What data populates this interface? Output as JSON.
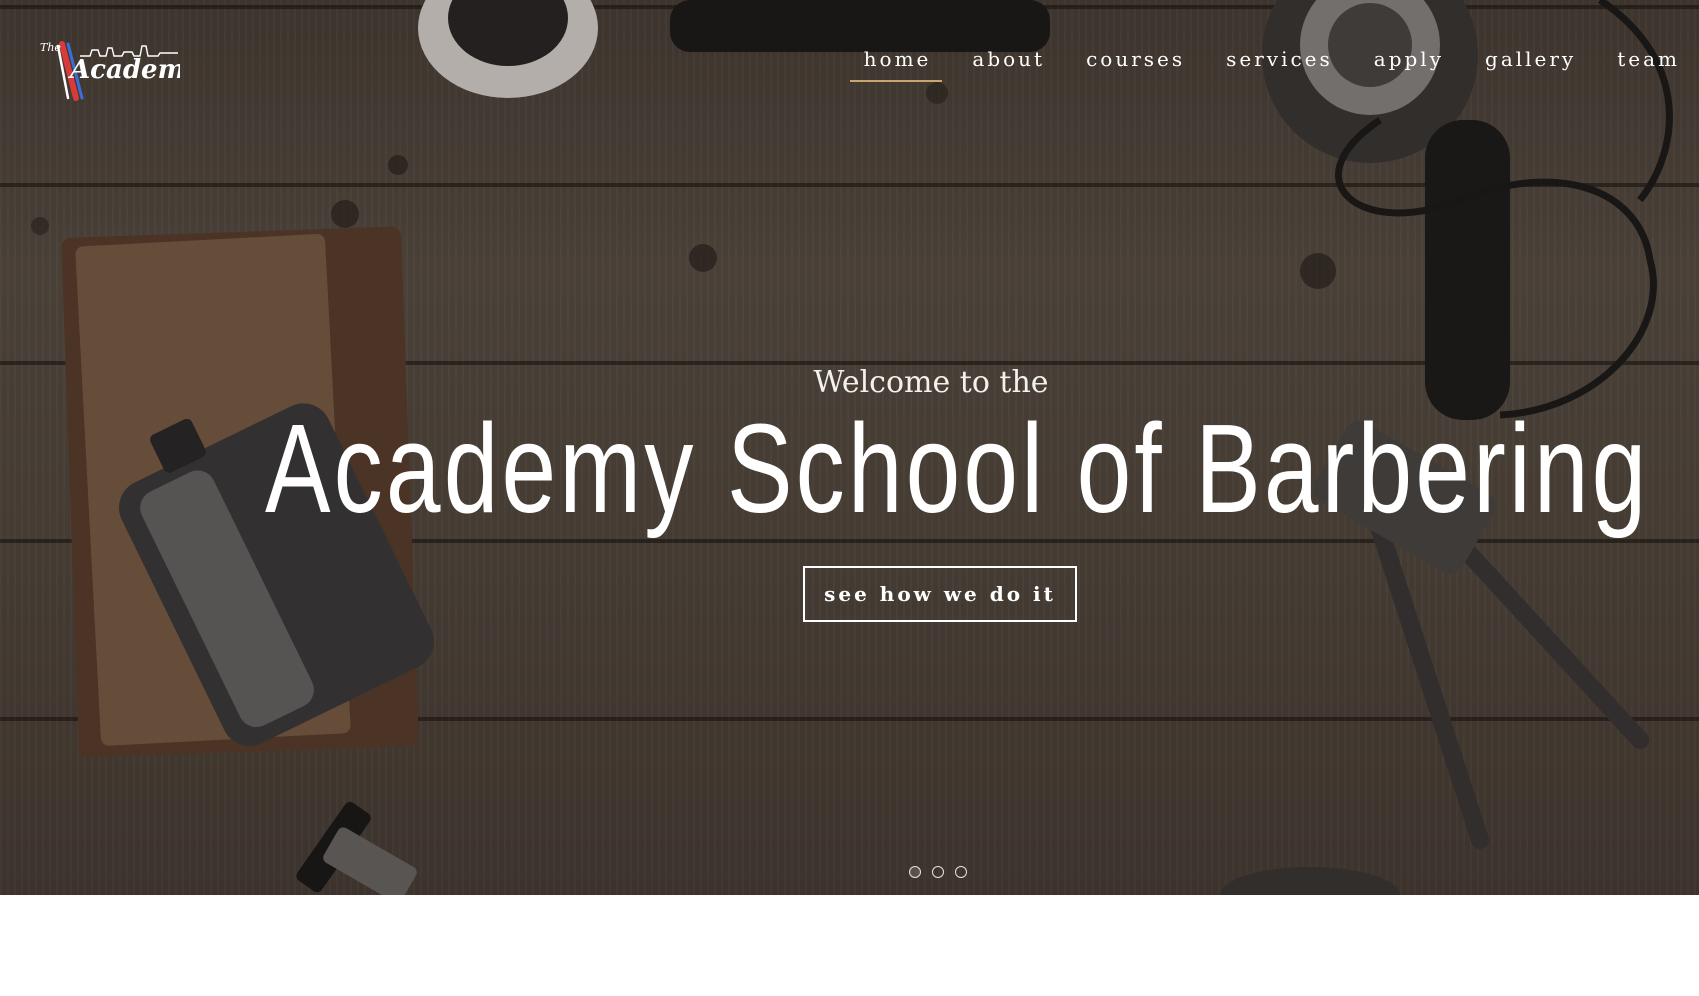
{
  "brand": {
    "logo_small_text": "The",
    "logo_text": "Academy"
  },
  "nav": {
    "items": [
      {
        "label": "home",
        "active": true
      },
      {
        "label": "about"
      },
      {
        "label": "courses"
      },
      {
        "label": "services"
      },
      {
        "label": "apply"
      },
      {
        "label": "gallery"
      },
      {
        "label": "team"
      }
    ]
  },
  "hero": {
    "welcome": "Welcome to the",
    "headline": "Academy School of Barbering",
    "cta_label": "see how we do it",
    "slides_total": 3,
    "active_slide": 1
  },
  "colors": {
    "accent_underline": "#c9a572",
    "hero_text": "#ffffff"
  }
}
